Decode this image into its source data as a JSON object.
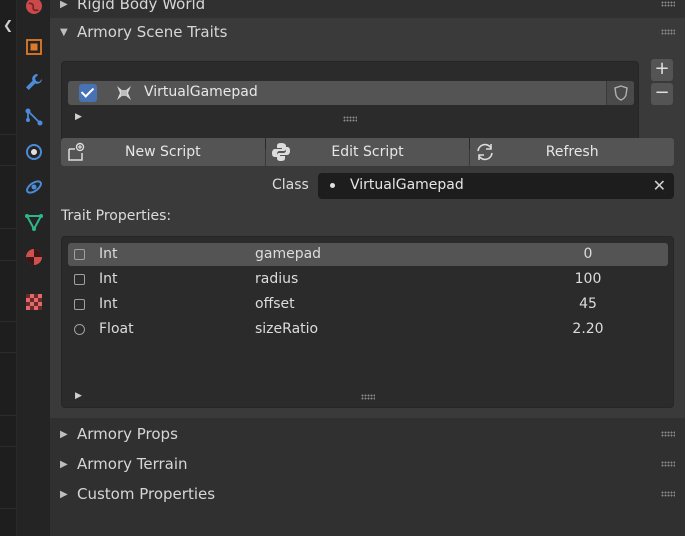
{
  "sections": {
    "top_partial": "Rigid Body World",
    "scene_traits": "Armory Scene Traits",
    "props": "Armory Props",
    "terrain": "Armory Terrain",
    "custom": "Custom Properties"
  },
  "trait_list": {
    "items": [
      {
        "name": "VirtualGamepad",
        "enabled": true
      }
    ],
    "add_label": "+",
    "remove_label": "−"
  },
  "script_buttons": {
    "new": "New Script",
    "edit": "Edit Script",
    "refresh": "Refresh"
  },
  "class_field": {
    "label": "Class",
    "value": "VirtualGamepad"
  },
  "trait_properties": {
    "label": "Trait Properties:",
    "rows": [
      {
        "type": "Int",
        "name": "gamepad",
        "value": "0"
      },
      {
        "type": "Int",
        "name": "radius",
        "value": "100"
      },
      {
        "type": "Int",
        "name": "offset",
        "value": "45"
      },
      {
        "type": "Float",
        "name": "sizeRatio",
        "value": "2.20"
      }
    ]
  },
  "colors": {
    "accent": "#4772b3",
    "panel_bg": "#3a3a3a",
    "list_bg": "#2b2b2b",
    "button_bg": "#545454"
  },
  "icons": {
    "tabs": [
      "world-icon",
      "object-icon",
      "wrench-icon",
      "constraint-icon",
      "physics-icon",
      "particles-icon",
      "data-icon",
      "material-icon",
      "texture-icon"
    ]
  }
}
